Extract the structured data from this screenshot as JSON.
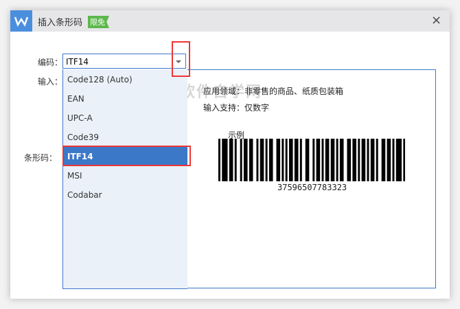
{
  "dialog": {
    "title": "插入条形码",
    "badge": "限免",
    "close": "×"
  },
  "labels": {
    "encoding": "编码：",
    "input": "输入：",
    "barcode": "条形码："
  },
  "select": {
    "value": "ITF14"
  },
  "options": [
    "Code128 (Auto)",
    "EAN",
    "UPC-A",
    "Code39",
    "ITF14",
    "MSI",
    "Codabar"
  ],
  "selected_index": 4,
  "preview": {
    "usage": "应用领域：非零售的商品、纸质包装箱",
    "support": "输入支持：仅数字",
    "example_label": "示例",
    "example_number": "37596507783323"
  },
  "watermark": "软件自学网",
  "colors": {
    "accent": "#3c78c8",
    "highlight": "#ee3535",
    "badge": "#5cb84c"
  }
}
